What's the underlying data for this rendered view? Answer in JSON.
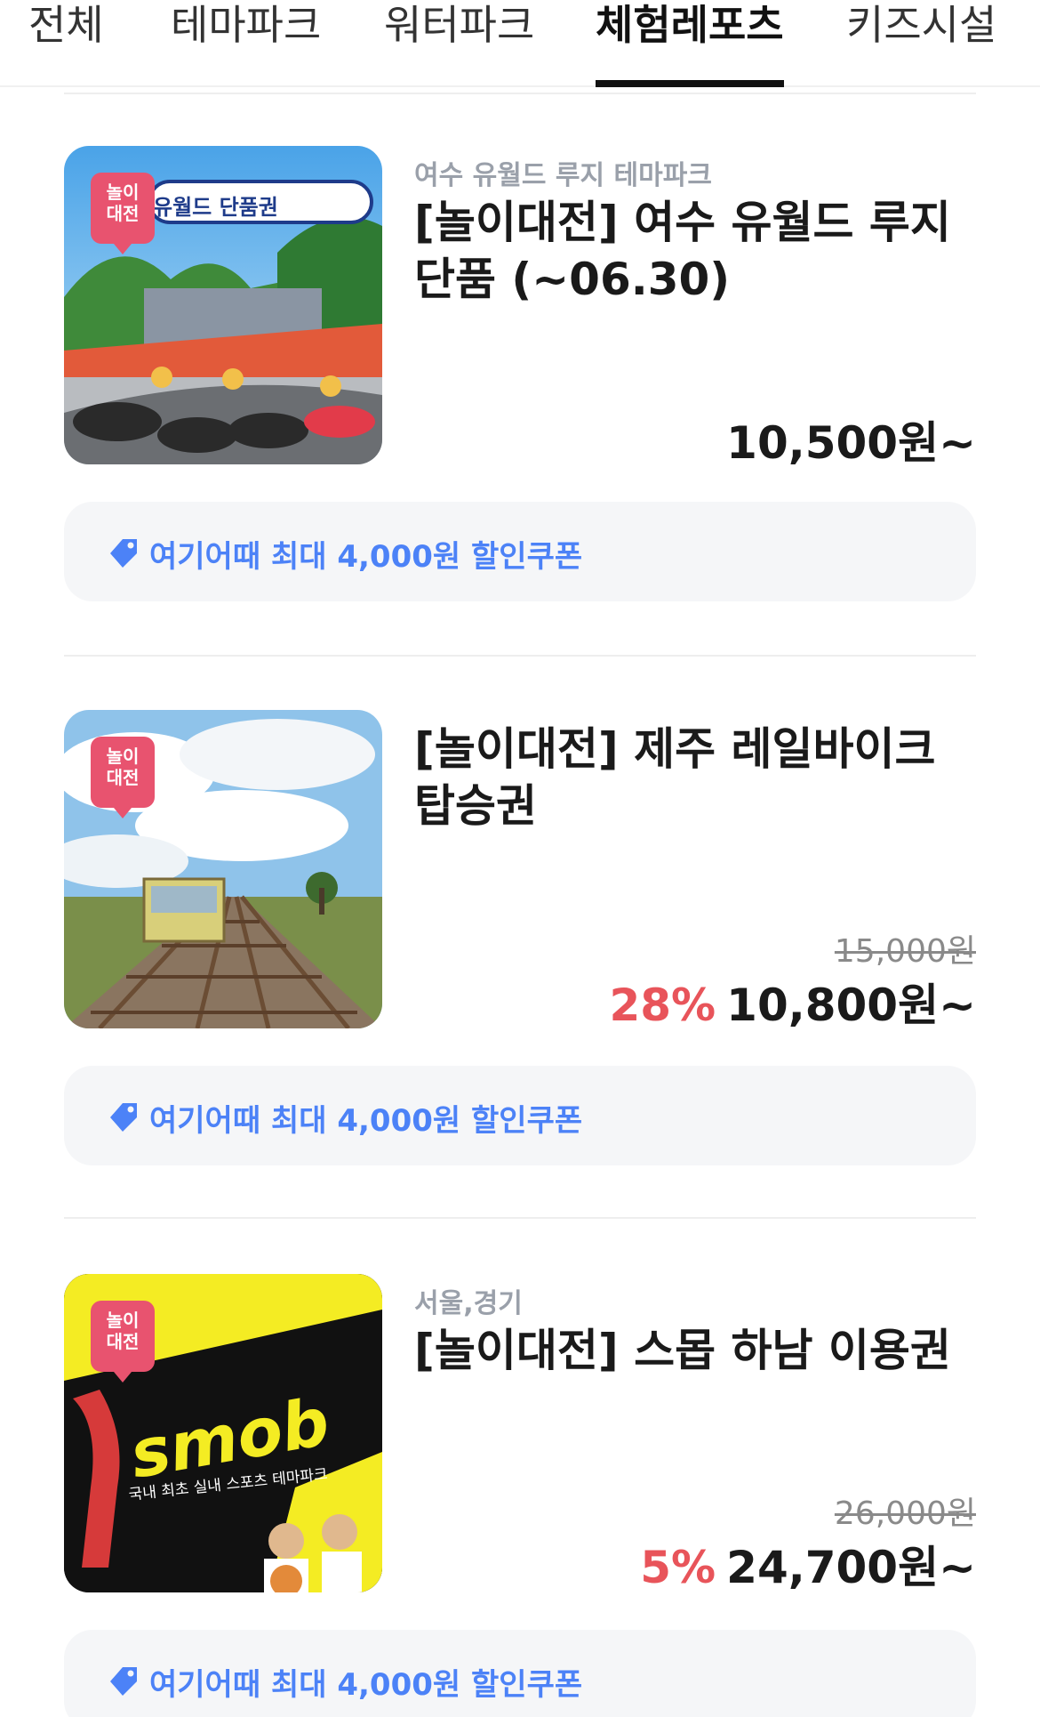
{
  "tabs": [
    {
      "label": "전체"
    },
    {
      "label": "테마파크"
    },
    {
      "label": "워터파크"
    },
    {
      "label": "체험레포츠"
    },
    {
      "label": "키즈시설"
    }
  ],
  "active_tab": "체험레포츠",
  "badge": {
    "line1": "놀이",
    "line2": "대전"
  },
  "items": [
    {
      "category": "여수 유월드 루지 테마파크",
      "title": "[놀이대전] 여수 유월드 루지 단품 (~06.30)",
      "image_caption": "유월드 단품권",
      "price": "10,500원~",
      "coupon": "여기어때 최대 4,000원 할인쿠폰"
    },
    {
      "title": "[놀이대전] 제주 레일바이크 탑승권",
      "original_price": "15,000원",
      "discount": "28%",
      "price": "10,800원~",
      "coupon": "여기어때 최대 4,000원 할인쿠폰"
    },
    {
      "category": "서울,경기",
      "title": "[놀이대전] 스몹 하남 이용권",
      "image_logo": "smob",
      "image_caption": "국내 최초 실내 스포츠 테마파크",
      "original_price": "26,000원",
      "discount": "5%",
      "price": "24,700원~",
      "coupon": "여기어때 최대 4,000원 할인쿠폰"
    }
  ],
  "colors": {
    "accent_blue": "#4c82f7",
    "discount_red": "#e8545a",
    "badge_pink": "#e8536f",
    "coupon_bg": "#f5f6f8"
  },
  "icons": [
    "tag-icon"
  ]
}
